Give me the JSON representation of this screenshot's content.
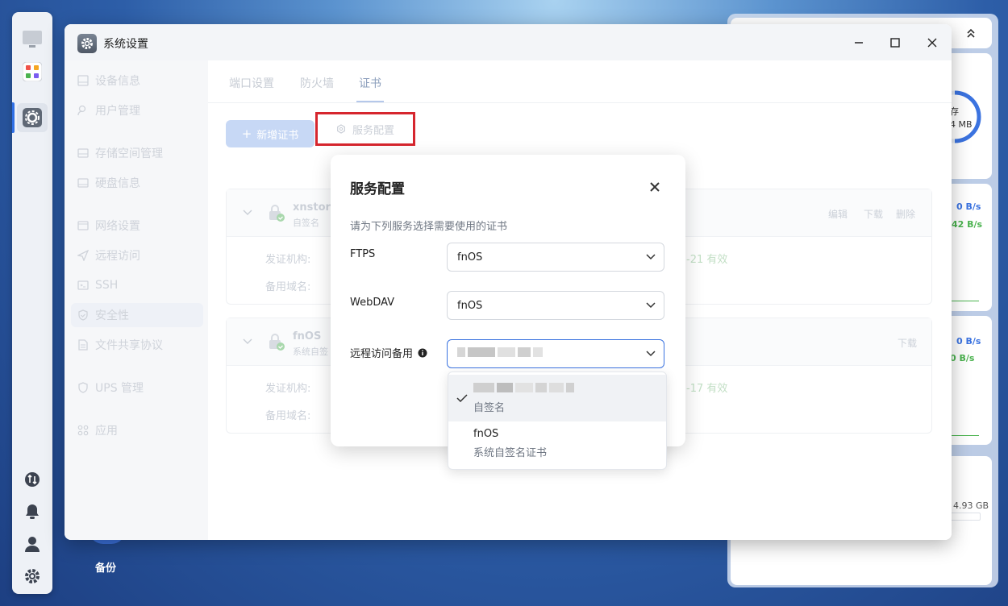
{
  "window": {
    "title": "系统设置"
  },
  "desktop": {
    "backup_label": "备份"
  },
  "sidebar": {
    "items": [
      {
        "label": "设备信息",
        "icon": "device-icon"
      },
      {
        "label": "用户管理",
        "icon": "user-icon"
      },
      {
        "label": "存储空间管理",
        "icon": "storage-icon"
      },
      {
        "label": "硬盘信息",
        "icon": "disk-icon"
      },
      {
        "label": "网络设置",
        "icon": "network-icon"
      },
      {
        "label": "远程访问",
        "icon": "remote-icon"
      },
      {
        "label": "SSH",
        "icon": "ssh-icon"
      },
      {
        "label": "安全性",
        "icon": "shield-icon"
      },
      {
        "label": "文件共享协议",
        "icon": "file-share-icon"
      },
      {
        "label": "UPS 管理",
        "icon": "ups-icon"
      },
      {
        "label": "应用",
        "icon": "apps-icon"
      }
    ],
    "active": "安全性"
  },
  "tabs": [
    {
      "label": "端口设置"
    },
    {
      "label": "防火墙"
    },
    {
      "label": "证书",
      "active": true
    }
  ],
  "toolbar": {
    "add_cert": "新增证书",
    "service_config": "服务配置"
  },
  "certs": [
    {
      "name": "xnstora",
      "subtitle": "自签名",
      "issuer_label": "发证机构:",
      "domain_label": "备用域名:",
      "validity": "-21 有效",
      "actions": [
        "编辑",
        "下载",
        "删除"
      ]
    },
    {
      "name": "fnOS",
      "subtitle": "系统自签",
      "issuer_label": "发证机构:",
      "domain_label": "备用域名:",
      "validity": "-17 有效",
      "actions": [
        "下载"
      ]
    }
  ],
  "modal": {
    "title": "服务配置",
    "description": "请为下列服务选择需要使用的证书",
    "fields": [
      {
        "label": "FTPS",
        "value": "fnOS"
      },
      {
        "label": "WebDAV",
        "value": "fnOS"
      },
      {
        "label": "远程访问备用",
        "value": ""
      }
    ]
  },
  "dropdown": {
    "options": [
      {
        "line2": "自签名",
        "selected": true
      },
      {
        "line1": "fnOS",
        "line2": "系统自签名证书",
        "selected": false
      }
    ]
  },
  "widgets": {
    "memory_label": "存",
    "memory_value": "4 MB",
    "net1_up": "0 B/s",
    "net1_down": "42 B/s",
    "net2_up": "0 B/s",
    "net2_down": "0 B/s",
    "storage": "4.93 GB"
  },
  "colors": {
    "accent": "#3b73e0",
    "highlight_red": "#d6262e",
    "valid_green": "#5cb85c"
  }
}
